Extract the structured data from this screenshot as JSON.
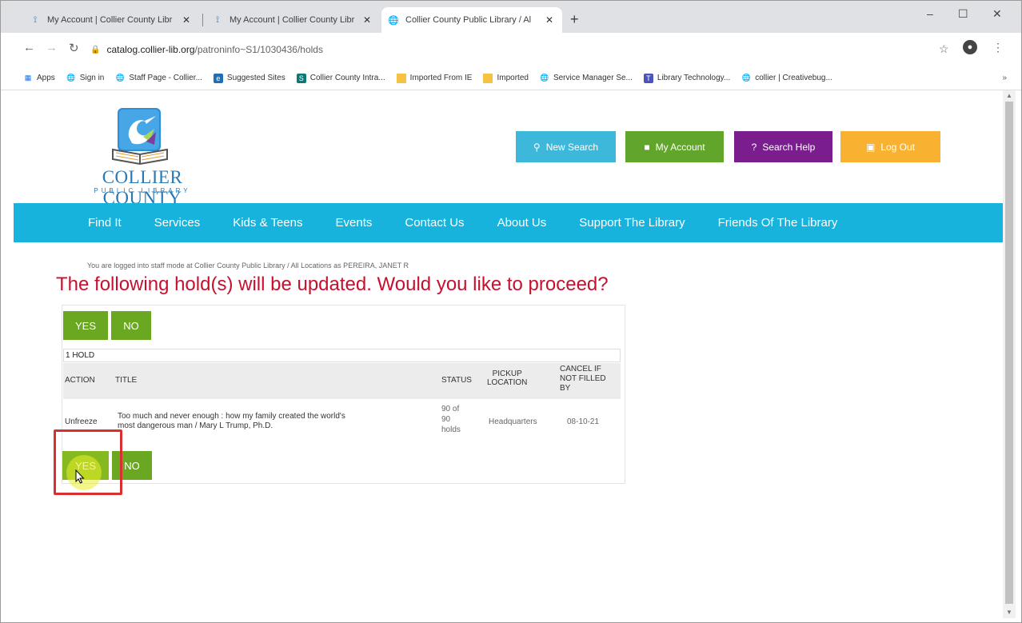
{
  "browser": {
    "tabs": [
      {
        "title": "My Account | Collier County Libr",
        "close": "✕",
        "active": false
      },
      {
        "title": "My Account | Collier County Libr",
        "close": "✕",
        "active": false
      },
      {
        "title": "Collier County Public Library / Al",
        "close": "✕",
        "active": true
      }
    ],
    "new_tab": "+",
    "window_controls": [
      "–",
      "☐",
      "✕"
    ],
    "url_host": "catalog.collier-lib.org",
    "url_path": "/patroninfo~S1/1030436/holds",
    "bookmarks": [
      {
        "label": "Apps",
        "icon": "apps-grid-icon"
      },
      {
        "label": "Sign in",
        "icon": "globe-icon"
      },
      {
        "label": "Staff Page - Collier...",
        "icon": "globe-icon"
      },
      {
        "label": "Suggested Sites",
        "icon": "ie-icon"
      },
      {
        "label": "Collier County Intra...",
        "icon": "sharepoint-icon"
      },
      {
        "label": "Imported From IE",
        "icon": "folder-icon"
      },
      {
        "label": "Imported",
        "icon": "folder-icon"
      },
      {
        "label": "Service Manager Se...",
        "icon": "globe-icon"
      },
      {
        "label": "Library Technology...",
        "icon": "teams-icon"
      },
      {
        "label": "collier | Creativebug...",
        "icon": "globe-icon"
      }
    ],
    "bookmarks_more": "»"
  },
  "logo": {
    "name": "COLLIER COUNTY",
    "sub": "PUBLIC LIBRARY"
  },
  "header_buttons": {
    "new_search": "New Search",
    "my_account": "My Account",
    "search_help": "Search Help",
    "log_out": "Log Out"
  },
  "nav": [
    "Find It",
    "Services",
    "Kids & Teens",
    "Events",
    "Contact Us",
    "About Us",
    "Support The Library",
    "Friends Of The Library"
  ],
  "staff_mode": "You are logged into staff mode at Collier County Public Library / All Locations as PEREIRA, JANET R",
  "prompt": "The following hold(s) will be updated. Would you like to proceed?",
  "buttons": {
    "yes": "YES",
    "no": "NO"
  },
  "hold_count": "1 HOLD",
  "table": {
    "headers": {
      "action": "ACTION",
      "title": "TITLE",
      "status": "STATUS",
      "pickup_line1": "PICKUP",
      "pickup_line2": "LOCATION",
      "cancel_line1": "CANCEL IF",
      "cancel_line2": "NOT FILLED",
      "cancel_line3": "BY"
    },
    "rows": [
      {
        "action": "Unfreeze",
        "title_line1": "Too much and never enough : how my family created the world's",
        "title_line2": "most dangerous man / Mary L Trump, Ph.D.",
        "status_line1": "90 of",
        "status_line2": "90",
        "status_line3": "holds",
        "pickup": "Headquarters",
        "cancel_by": "08-10-21"
      }
    ]
  },
  "colors": {
    "nav_bar": "#17b3dc",
    "new_search": "#3db8da",
    "my_account": "#61a62a",
    "search_help": "#7a1e8e",
    "log_out": "#f9b132",
    "prompt": "#c8102e",
    "button_green": "#6aa821",
    "highlight_box": "#d9302f"
  }
}
